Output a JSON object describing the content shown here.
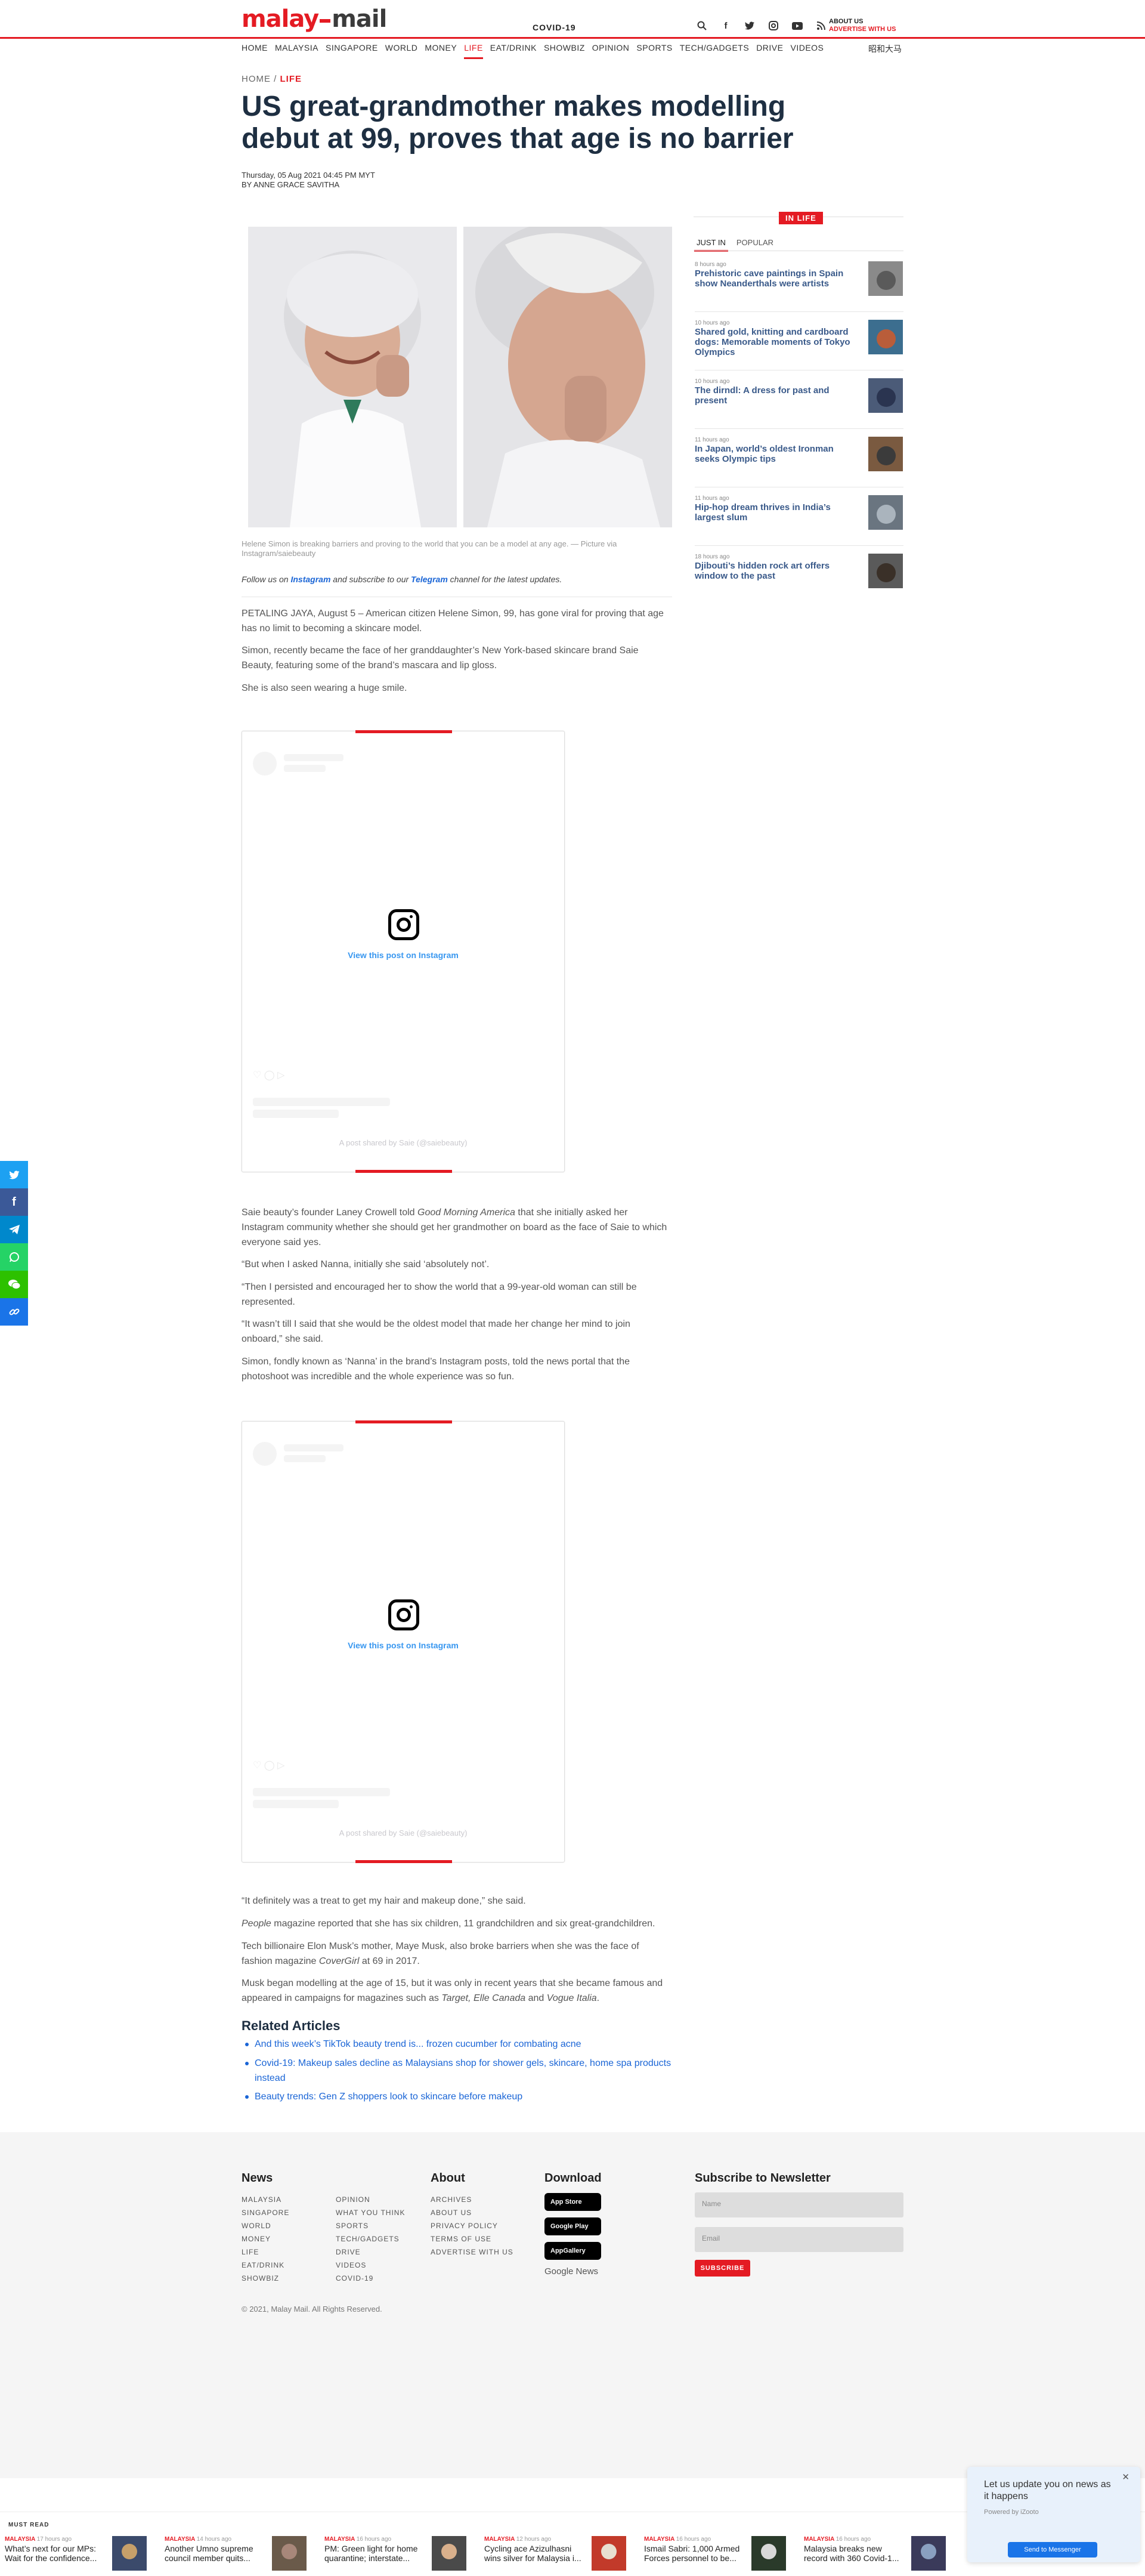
{
  "header": {
    "logo_left": "malay",
    "logo_right": "mail",
    "logo_tag": "MALAY MAIL",
    "covid_label": "COVID-19",
    "about_label": "ABOUT US",
    "advertise_label": "ADVERTISE WITH US",
    "icons": [
      "search-icon",
      "facebook-icon",
      "twitter-icon",
      "instagram-icon",
      "youtube-icon",
      "rss-icon"
    ]
  },
  "nav": {
    "items": [
      "HOME",
      "MALAYSIA",
      "SINGAPORE",
      "WORLD",
      "MONEY",
      "LIFE",
      "EAT/DRINK",
      "SHOWBIZ",
      "OPINION",
      "SPORTS",
      "TECH/GADGETS",
      "DRIVE",
      "VIDEOS"
    ],
    "active": "LIFE",
    "chinese_label": "昭和大马"
  },
  "breadcrumb": {
    "home": "HOME",
    "sep": "/",
    "section": "LIFE"
  },
  "article": {
    "title": "US great-grandmother makes modelling debut at 99, proves that age is no barrier",
    "date": "Thursday, 05 Aug 2021 04:45 PM MYT",
    "byline": "BY ANNE GRACE SAVITHA",
    "caption": "Helene Simon is breaking barriers and proving to the world that you can be a model at any age. — Picture via Instagram/saiebeauty",
    "follow_prefix": "Follow us on",
    "follow_instagram": "Instagram",
    "follow_middle": "and subscribe to our",
    "follow_telegram": "Telegram",
    "follow_suffix": "channel for the latest updates.",
    "paragraphs_1": [
      "PETALING JAYA, August 5 – American citizen Helene Simon, 99, has gone viral for proving that age has no limit to becoming a skincare model.",
      "Simon, recently became the face of her granddaughter’s New York-based skincare brand Saie Beauty, featuring some of the brand’s mascara and lip gloss.",
      "She is also seen wearing a huge smile."
    ],
    "paragraphs_2": [
      "Saie beauty’s founder Laney Crowell told Good Morning America that she initially asked her Instagram community whether she should get her grandmother on board as the face of Saie to which everyone said yes.",
      "“But when I asked Nanna, initially she said ‘absolutely not’.",
      "“Then I persisted and encouraged her to show the world that a 99-year-old woman can still be represented.",
      "“It wasn’t till I said that she would be the oldest model that made her change her mind to join onboard,” she said.",
      "Simon, fondly known as ‘Nanna’ in the brand’s Instagram posts, told the news portal that the photoshoot was incredible and the whole experience was so fun."
    ],
    "paragraphs_3": [
      "“It definitely was a treat to get my hair and makeup done,” she said.",
      "People magazine reported that she has six children, 11 grandchildren and six great-grandchildren.",
      "Tech billionaire Elon Musk’s mother, Maye Musk, also broke barriers when she was the face of fashion magazine CoverGirl at 69 in 2017.",
      "Musk began modelling at the age of 15, but it was only in recent years that she became famous and appeared in campaigns for magazines such as Target, Elle Canada and Vogue Italia."
    ]
  },
  "instagram_embed": {
    "view_label": "View this post on Instagram",
    "credit": "A post shared by Saie (@saiebeauty)"
  },
  "related": {
    "heading": "Related Articles",
    "items": [
      "And this week’s TikTok beauty trend is... frozen cucumber for combating acne",
      "Covid-19: Makeup sales decline as Malaysians shop for shower gels, skincare, home spa products instead",
      "Beauty trends: Gen Z shoppers look to skincare before makeup"
    ]
  },
  "sidebar": {
    "badge": "IN LIFE",
    "tabs": [
      "JUST IN",
      "POPULAR"
    ],
    "items": [
      {
        "time": "8 hours ago",
        "title": "Prehistoric cave paintings in Spain show Neanderthals were artists"
      },
      {
        "time": "10 hours ago",
        "title": "Shared gold, knitting and cardboard dogs: Memorable moments of Tokyo Olympics"
      },
      {
        "time": "10 hours ago",
        "title": "The dirndl: A dress for past and present"
      },
      {
        "time": "11 hours ago",
        "title": "In Japan, world’s oldest Ironman seeks Olympic tips"
      },
      {
        "time": "11 hours ago",
        "title": "Hip-hop dream thrives in India’s largest slum"
      },
      {
        "time": "18 hours ago",
        "title": "Djibouti’s hidden rock art offers window to the past"
      }
    ]
  },
  "share": [
    "twitter-icon",
    "facebook-icon",
    "telegram-icon",
    "whatsapp-icon",
    "wechat-icon",
    "link-icon"
  ],
  "footer": {
    "news_heading": "News",
    "news_col1": [
      "MALAYSIA",
      "SINGAPORE",
      "WORLD",
      "MONEY",
      "LIFE",
      "EAT/DRINK",
      "SHOWBIZ"
    ],
    "news_col2": [
      "OPINION",
      "WHAT YOU THINK",
      "SPORTS",
      "TECH/GADGETS",
      "DRIVE",
      "VIDEOS",
      "COVID-19"
    ],
    "about_heading": "About",
    "about_items": [
      "ARCHIVES",
      "ABOUT US",
      "PRIVACY POLICY",
      "TERMS OF USE",
      "ADVERTISE WITH US"
    ],
    "download_heading": "Download",
    "stores": [
      "App Store",
      "Google Play",
      "AppGallery"
    ],
    "google_news": "Google News",
    "newsletter_heading": "Subscribe to Newsletter",
    "name_placeholder": "Name",
    "email_placeholder": "Email",
    "subscribe_label": "SUBSCRIBE",
    "copyright": "© 2021, Malay Mail. All Rights Reserved."
  },
  "must_read": {
    "label": "MUST READ",
    "items": [
      {
        "cat": "MALAYSIA",
        "time": "17 hours ago",
        "title": "What’s next for our MPs: Wait for the confidence..."
      },
      {
        "cat": "MALAYSIA",
        "time": "14 hours ago",
        "title": "Another Umno supreme council member quits..."
      },
      {
        "cat": "MALAYSIA",
        "time": "16 hours ago",
        "title": "PM: Green light for home quarantine; interstate..."
      },
      {
        "cat": "MALAYSIA",
        "time": "12 hours ago",
        "title": "Cycling ace Azizulhasni wins silver for Malaysia i..."
      },
      {
        "cat": "MALAYSIA",
        "time": "16 hours ago",
        "title": "Ismail Sabri: 1,000 Armed Forces personnel to be..."
      },
      {
        "cat": "MALAYSIA",
        "time": "16 hours ago",
        "title": "Malaysia breaks new record with 360 Covid-1..."
      }
    ]
  },
  "notification": {
    "message": "Let us update you on news as it happens",
    "powered": "Powered by iZooto",
    "button": "Send to Messenger"
  },
  "colors": {
    "brand_red": "#e41b23",
    "title_navy": "#1e2f42",
    "link_blue": "#1a65d6"
  }
}
